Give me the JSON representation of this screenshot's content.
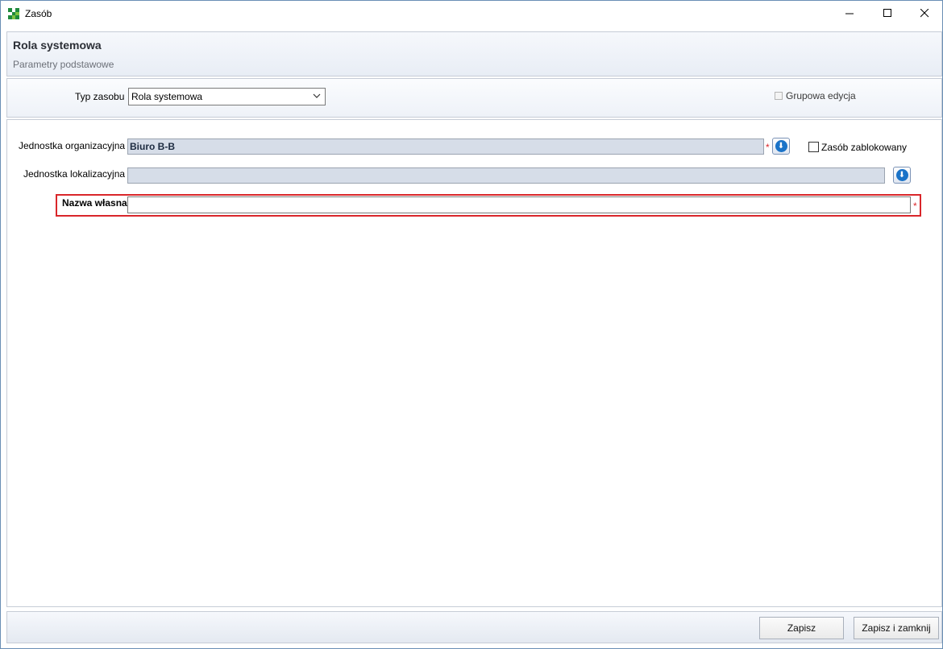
{
  "window": {
    "title": "Zasób",
    "controls": {
      "minimize": "—",
      "maximize": "☐",
      "close": "✕"
    }
  },
  "header": {
    "title": "Rola systemowa",
    "subtitle": "Parametry podstawowe"
  },
  "type_panel": {
    "type_label": "Typ zasobu",
    "type_value": "Rola systemowa",
    "group_edit_label": "Grupowa edycja",
    "group_edit_checked": false
  },
  "form": {
    "org_unit_label": "Jednostka organizacyjna",
    "org_unit_value": "Biuro B-B",
    "required_mark": "*",
    "locked_label": "Zasób zablokowany",
    "locked_checked": false,
    "location_unit_label": "Jednostka lokalizacyjna",
    "location_unit_value": "",
    "name_label": "Nazwa własna",
    "name_value": ""
  },
  "footer": {
    "save_label": "Zapisz",
    "save_close_label": "Zapisz i zamknij"
  },
  "colors": {
    "required": "#d9262a",
    "highlight": "#d9262a",
    "lookup_button": "#1a73c8",
    "readonly_field": "#d6dde8"
  }
}
